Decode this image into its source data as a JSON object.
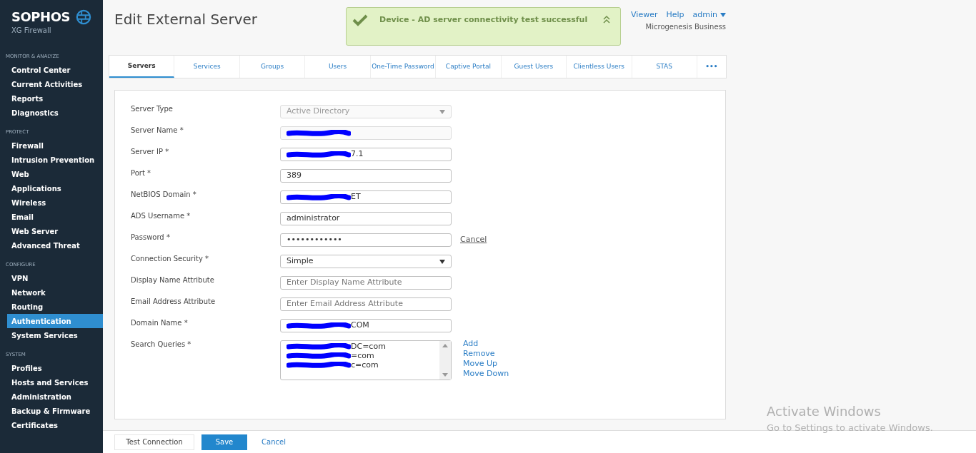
{
  "brand": {
    "name": "SOPHOS",
    "product": "XG Firewall"
  },
  "sidebar": [
    {
      "heading": "MONITOR & ANALYZE",
      "items": [
        {
          "label": "Control Center",
          "selected": false
        },
        {
          "label": "Current Activities",
          "selected": false
        },
        {
          "label": "Reports",
          "selected": false
        },
        {
          "label": "Diagnostics",
          "selected": false
        }
      ]
    },
    {
      "heading": "PROTECT",
      "items": [
        {
          "label": "Firewall",
          "selected": false
        },
        {
          "label": "Intrusion Prevention",
          "selected": false
        },
        {
          "label": "Web",
          "selected": false
        },
        {
          "label": "Applications",
          "selected": false
        },
        {
          "label": "Wireless",
          "selected": false
        },
        {
          "label": "Email",
          "selected": false
        },
        {
          "label": "Web Server",
          "selected": false
        },
        {
          "label": "Advanced Threat",
          "selected": false
        }
      ]
    },
    {
      "heading": "CONFIGURE",
      "items": [
        {
          "label": "VPN",
          "selected": false
        },
        {
          "label": "Network",
          "selected": false
        },
        {
          "label": "Routing",
          "selected": false
        },
        {
          "label": "Authentication",
          "selected": true
        },
        {
          "label": "System Services",
          "selected": false
        }
      ]
    },
    {
      "heading": "SYSTEM",
      "items": [
        {
          "label": "Profiles",
          "selected": false
        },
        {
          "label": "Hosts and Services",
          "selected": false
        },
        {
          "label": "Administration",
          "selected": false
        },
        {
          "label": "Backup & Firmware",
          "selected": false
        },
        {
          "label": "Certificates",
          "selected": false
        }
      ]
    }
  ],
  "page_title": "Edit External Server",
  "header": {
    "links": [
      "Viewer",
      "Help"
    ],
    "user": "admin",
    "organization": "Microgenesis Business"
  },
  "notification": {
    "message": "Device - AD server connectivity test successful"
  },
  "tabs": [
    {
      "label": "Servers",
      "selected": true
    },
    {
      "label": "Services",
      "selected": false
    },
    {
      "label": "Groups",
      "selected": false
    },
    {
      "label": "Users",
      "selected": false
    },
    {
      "label": "One-Time Password",
      "selected": false
    },
    {
      "label": "Captive Portal",
      "selected": false
    },
    {
      "label": "Guest Users",
      "selected": false
    },
    {
      "label": "Clientless Users",
      "selected": false
    },
    {
      "label": "STAS",
      "selected": false
    },
    {
      "label": "•••",
      "selected": false
    }
  ],
  "form": [
    {
      "kind": "select",
      "label": "Server Type",
      "value": "Active Directory",
      "disabled": true
    },
    {
      "kind": "text",
      "label": "Server Name *",
      "redacted": true,
      "disabled": true
    },
    {
      "kind": "text",
      "label": "Server IP *",
      "value": "7.1",
      "redacted": true
    },
    {
      "kind": "text",
      "label": "Port *",
      "value": "389"
    },
    {
      "kind": "text",
      "label": "NetBIOS Domain *",
      "value": "ET",
      "redacted": true
    },
    {
      "kind": "text",
      "label": "ADS Username *",
      "value": "administrator"
    },
    {
      "kind": "password",
      "label": "Password *",
      "value": "••••••••••••",
      "action": "Cancel"
    },
    {
      "kind": "select",
      "label": "Connection Security *",
      "value": "Simple",
      "disabled": false
    },
    {
      "kind": "text",
      "label": "Display Name Attribute",
      "placeholder": "Enter Display Name Attribute"
    },
    {
      "kind": "text",
      "label": "Email Address Attribute",
      "placeholder": "Enter Email Address Attribute"
    },
    {
      "kind": "text",
      "label": "Domain Name *",
      "value": "COM",
      "redacted": true
    },
    {
      "kind": "list",
      "label": "Search Queries *",
      "redacted": true,
      "entries": [
        "DC=com",
        "=com",
        "c=com"
      ],
      "actions": [
        "Add",
        "Remove",
        "Move Up",
        "Move Down"
      ]
    }
  ],
  "footer": {
    "buttons": [
      {
        "label": "Test Connection",
        "kind": "secondary"
      },
      {
        "label": "Save",
        "kind": "primary"
      },
      {
        "label": "Cancel",
        "kind": "link"
      }
    ]
  },
  "os_notice": {
    "title": "Activate Windows",
    "text": "Go to Settings to activate Windows."
  }
}
